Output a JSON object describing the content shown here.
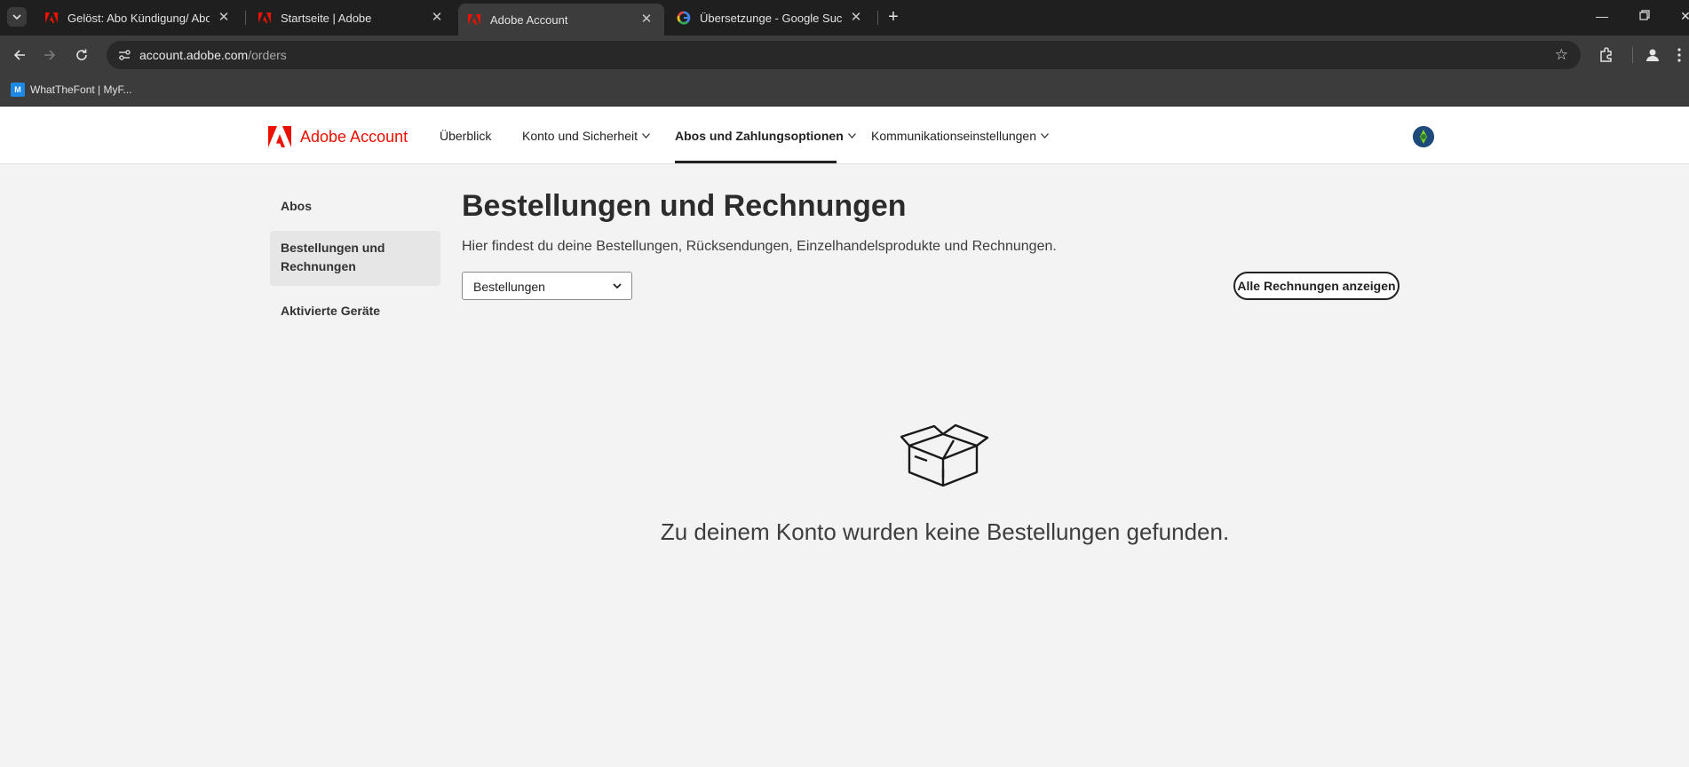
{
  "browser": {
    "tabs": [
      {
        "title": "Gelöst: Abo Kündigung/ Abo w",
        "favicon": "adobe-icon",
        "active": false
      },
      {
        "title": "Startseite | Adobe",
        "favicon": "adobe-icon",
        "active": false
      },
      {
        "title": "Adobe Account",
        "favicon": "adobe-icon",
        "active": true
      },
      {
        "title": "Übersetzunge - Google Suche",
        "favicon": "google-icon",
        "active": false
      }
    ],
    "url_host": "account.adobe.com",
    "url_path": "/orders",
    "bookmarks": [
      {
        "label": "WhatTheFont | MyF...",
        "favicon": "whatthefont-icon"
      }
    ]
  },
  "header": {
    "brand": "Adobe Account",
    "nav": [
      {
        "label": "Überblick",
        "has_dropdown": false,
        "active": false
      },
      {
        "label": "Konto und Sicherheit",
        "has_dropdown": true,
        "active": false
      },
      {
        "label": "Abos und Zahlungsoptionen",
        "has_dropdown": true,
        "active": true
      },
      {
        "label": "Kommunikationseinstellungen",
        "has_dropdown": true,
        "active": false
      }
    ]
  },
  "sidebar": {
    "items": [
      {
        "label": "Abos",
        "selected": false
      },
      {
        "label": "Bestellungen und Rechnungen",
        "selected": true
      },
      {
        "label": "Aktivierte Geräte",
        "selected": false
      }
    ]
  },
  "main": {
    "title": "Bestellungen und Rechnungen",
    "subtitle": "Hier findest du deine Bestellungen, Rücksendungen, Einzelhandelsprodukte und Rechnungen.",
    "filter_value": "Bestellungen",
    "all_invoices_button": "Alle Rechnungen anzeigen",
    "empty_message": "Zu deinem Konto wurden keine Bestellungen gefunden."
  },
  "colors": {
    "adobe_red": "#eb1000",
    "browser_dark": "#1f1f1f",
    "page_bg": "#f3f3f3"
  }
}
